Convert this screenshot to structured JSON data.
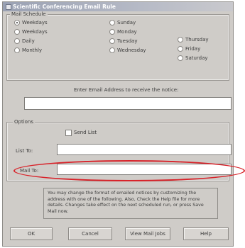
{
  "dialog": {
    "title": "Scientific Conferencing Email Rule",
    "weekday_group_label": "Mail Schedule",
    "weekdays": [
      {
        "label": "Weekdays",
        "checked": true
      },
      {
        "label": "Weekdays",
        "checked": false
      },
      {
        "label": "Daily",
        "checked": false
      },
      {
        "label": "Monthly",
        "checked": false
      },
      {
        "label": "Sunday",
        "checked": false
      },
      {
        "label": "Monday",
        "checked": false
      },
      {
        "label": "Tuesday",
        "checked": false
      },
      {
        "label": "Wednesday",
        "checked": false
      },
      {
        "label": "Thursday",
        "checked": false
      },
      {
        "label": "Friday",
        "checked": false
      },
      {
        "label": "Saturday",
        "checked": false
      }
    ],
    "email_prompt": "Enter Email Address to receive the notice:",
    "email_value": "",
    "options_group_label": "Options",
    "send_list_label": "Send List",
    "list_field_label": "List To:",
    "list_value": "",
    "mail_to_label": "Mail To:",
    "mail_to_value": "",
    "hint_text": "You may change the format of emailed notices by customizing the address with one of the following. Also, Check the Help file for more details. Changes take effect on the next scheduled run, or press Save Mail now.",
    "buttons": {
      "ok": "OK",
      "cancel": "Cancel",
      "view_mail": "View Mail Jobs",
      "help": "Help"
    }
  }
}
